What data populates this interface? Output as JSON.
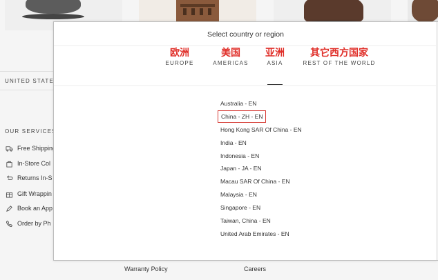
{
  "background": {
    "country_label": "UNITED STATES",
    "services_title": "OUR SERVICES",
    "services": [
      {
        "label": "Free Shipping",
        "icon": "truck-icon"
      },
      {
        "label": "In-Store Col",
        "icon": "bag-icon"
      },
      {
        "label": "Returns In-S",
        "icon": "return-icon"
      },
      {
        "label": "Gift Wrappin",
        "icon": "gift-icon"
      },
      {
        "label": "Book an App",
        "icon": "pen-icon"
      },
      {
        "label": "Order by Ph",
        "icon": "phone-icon"
      }
    ],
    "footer_links": [
      "Warranty Policy",
      "Careers"
    ]
  },
  "modal": {
    "title": "Select country or region",
    "tabs": [
      {
        "cn": "欧洲",
        "en": "EUROPE"
      },
      {
        "cn": "美国",
        "en": "AMERICAS"
      },
      {
        "cn": "亚洲",
        "en": "ASIA"
      },
      {
        "cn": "其它西方国家",
        "en": "REST OF THE WORLD"
      }
    ],
    "active_tab": "ASIA",
    "countries": [
      "Australia - EN",
      "China - ZH - EN",
      "Hong Kong SAR Of China - EN",
      "India - EN",
      "Indonesia - EN",
      "Japan - JA - EN",
      "Macau SAR Of China - EN",
      "Malaysia - EN",
      "Singapore - EN",
      "Taiwan, China - EN",
      "United Arab Emirates - EN"
    ],
    "highlighted_country": "China - ZH - EN"
  },
  "colors": {
    "accent_red": "#e0302a",
    "highlight_border": "#d63a34"
  }
}
